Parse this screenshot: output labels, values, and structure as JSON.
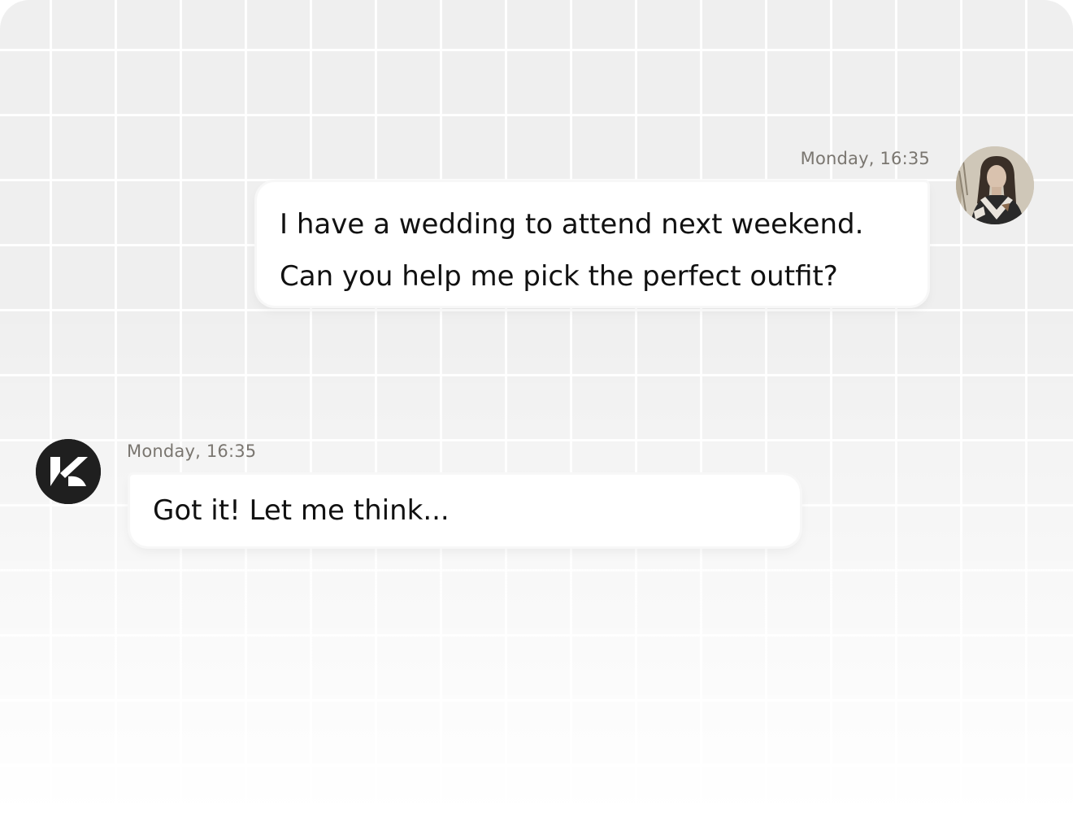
{
  "conversation": {
    "messages": [
      {
        "sender": "user",
        "timestamp": "Monday,  16:35",
        "lines": [
          "I have a wedding to attend next weekend.",
          "Can you help me pick the perfect outfit?"
        ],
        "avatar_icon": "user-photo-avatar"
      },
      {
        "sender": "assistant",
        "timestamp": "Monday,  16:35",
        "lines": [
          "Got it! Let me think..."
        ],
        "avatar_icon": "brand-k-logo-icon"
      }
    ]
  },
  "colors": {
    "background": "#efefef",
    "grid_line": "#ffffff",
    "bubble": "#ffffff",
    "text": "#111111",
    "timestamp": "#7a7670",
    "bot_avatar": "#1f1f1f"
  }
}
